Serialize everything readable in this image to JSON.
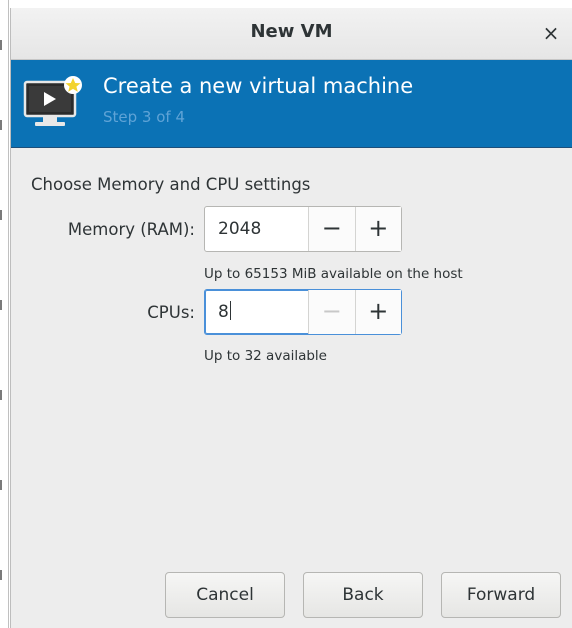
{
  "window": {
    "title": "New VM",
    "close_glyph": "×"
  },
  "banner": {
    "title": "Create a new virtual machine",
    "step": "Step 3 of 4",
    "icon": "monitor-star-icon",
    "background_color": "#0b72b5"
  },
  "content": {
    "section_label": "Choose Memory and CPU settings",
    "memory": {
      "label": "Memory (RAM):",
      "value": "2048",
      "decrement": "−",
      "increment": "+",
      "hint": "Up to 65153 MiB available on the host"
    },
    "cpus": {
      "label": "CPUs:",
      "value": "8",
      "decrement": "−",
      "increment": "+",
      "decrement_disabled": true,
      "hint": "Up to 32 available"
    }
  },
  "buttons": {
    "cancel": "Cancel",
    "back": "Back",
    "forward": "Forward"
  }
}
